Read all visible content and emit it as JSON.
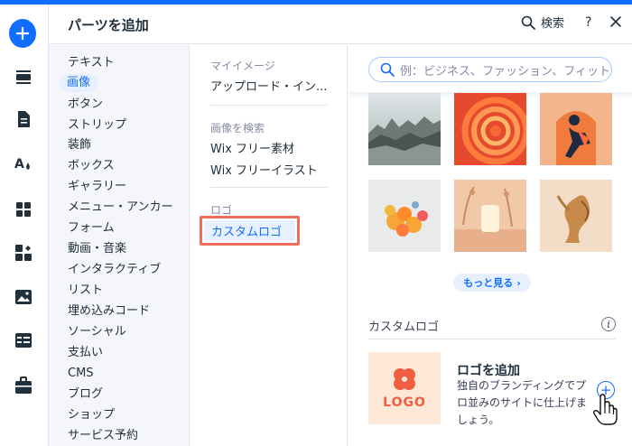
{
  "header": {
    "title": "パーツを追加",
    "search_label": "検索",
    "help_label": "?"
  },
  "app_sidebar": {
    "items": [
      "add-elements",
      "sections",
      "pages",
      "design",
      "app-market",
      "business-tools",
      "media",
      "cms",
      "portfolio"
    ]
  },
  "categories": {
    "items": [
      "テキスト",
      "画像",
      "ボタン",
      "ストリップ",
      "装飾",
      "ボックス",
      "ギャラリー",
      "メニュー・アンカー",
      "フォーム",
      "動画・音楽",
      "インタラクティブ",
      "リスト",
      "埋め込みコード",
      "ソーシャル",
      "支払い",
      "CMS",
      "ブログ",
      "ショップ",
      "サービス予約"
    ],
    "active_index": 1
  },
  "subcategories": {
    "my_images_heading": "マイイメージ",
    "upload_label": "アップロード・イン...",
    "search_images_heading": "画像を検索",
    "wix_free_media": "Wix フリー素材",
    "wix_free_illustrations": "Wix フリーイラスト",
    "logo_heading": "ロゴ",
    "custom_logo_active": "カスタムロゴ"
  },
  "main": {
    "search_placeholder": "例：ビジネス、ファッション、フィットネス",
    "more_button": "もっと見る",
    "more_chevron": "›",
    "section_title": "カスタムロゴ",
    "info_icon_glyph": "i",
    "logo_card": {
      "thumb_text": "LOGO",
      "title": "ロゴを追加",
      "description": "独自のブランディングでプロ並みのサイトに仕上げましょう。",
      "plus": "+"
    }
  },
  "colors": {
    "accent": "#116dff",
    "highlight_border": "#f26b5b",
    "logo_orange": "#f05d3f",
    "logo_bg": "#fde8d8"
  }
}
